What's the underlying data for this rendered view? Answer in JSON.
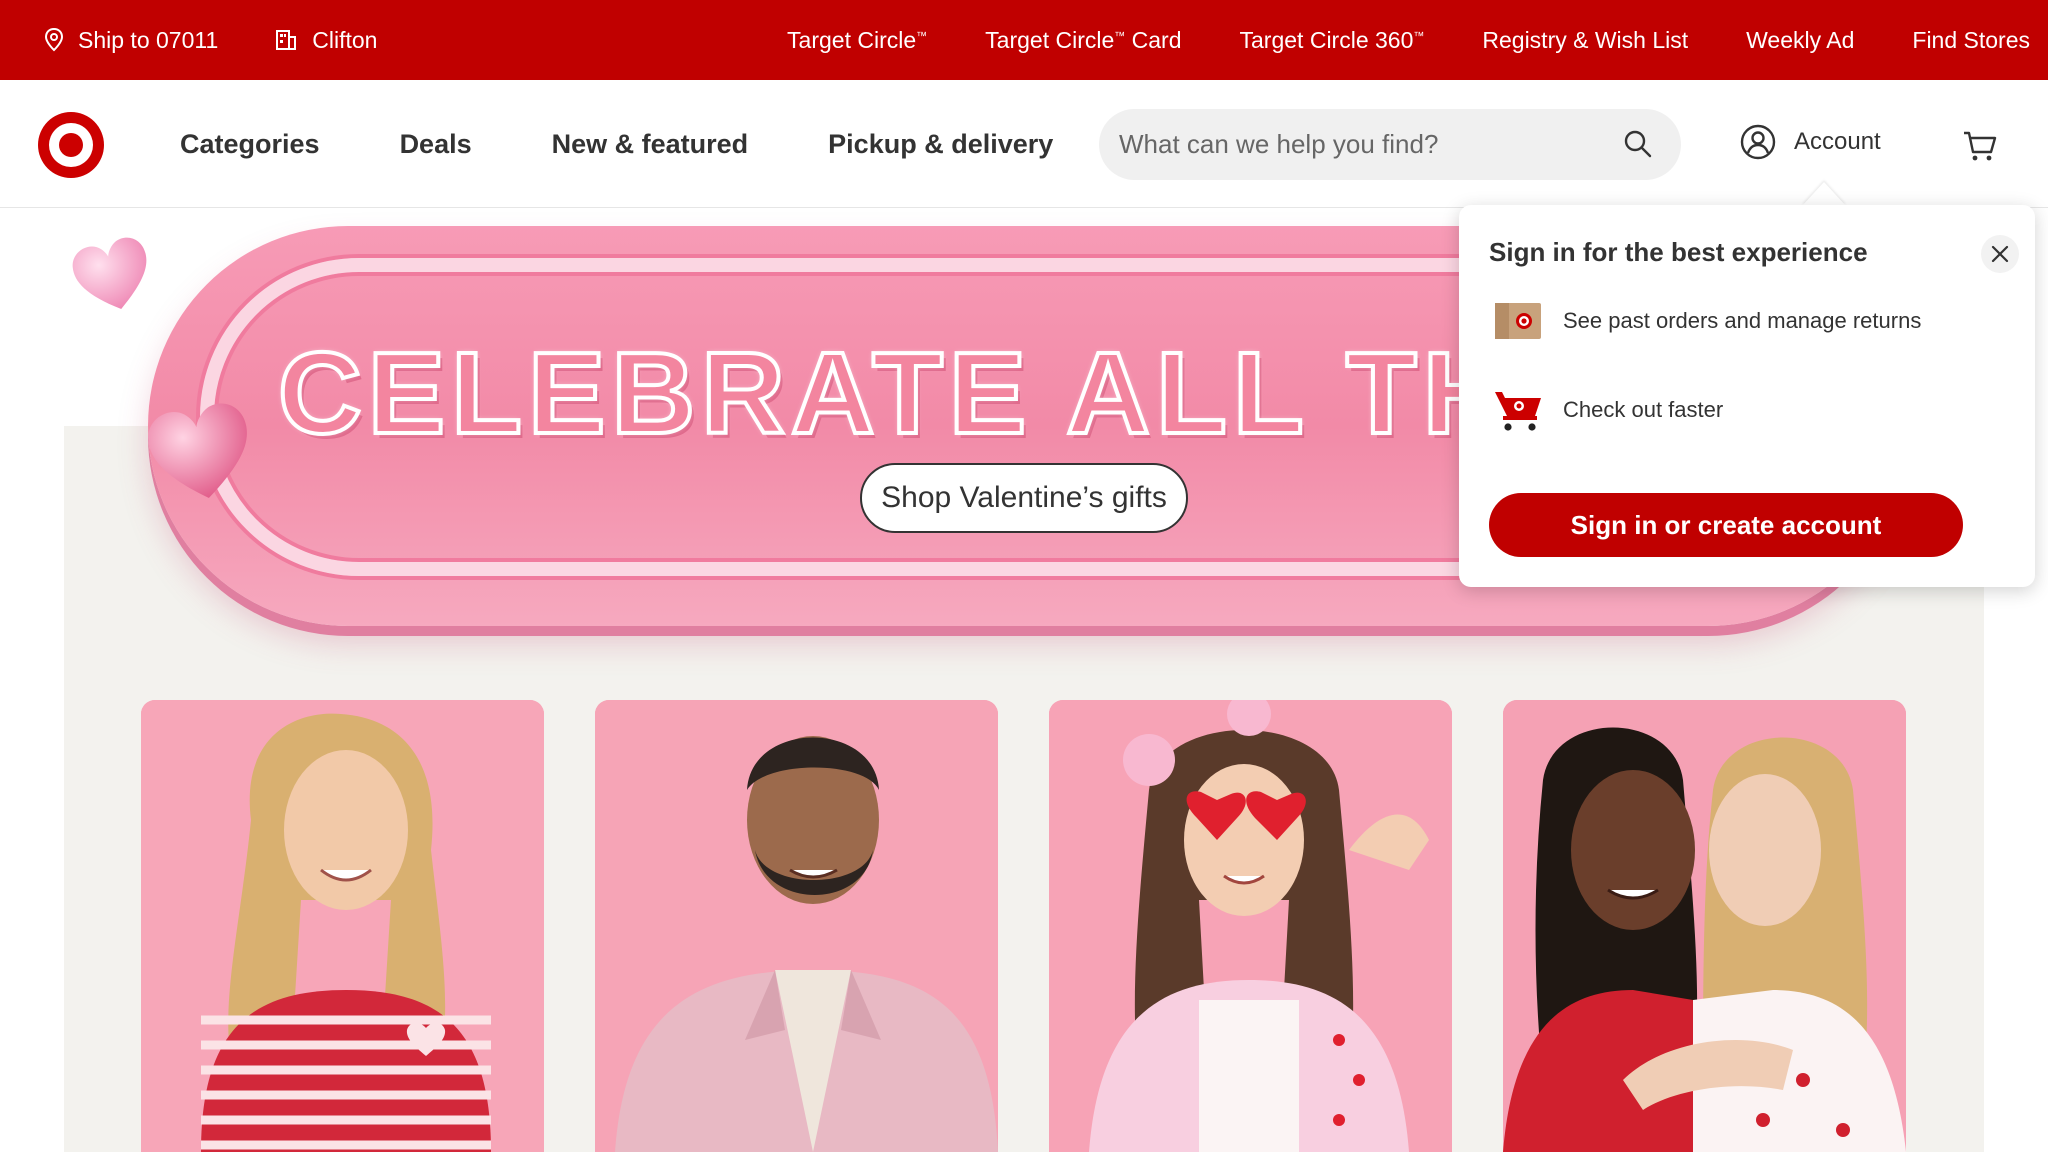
{
  "utility_bar": {
    "ship_to": "Ship to 07011",
    "store": "Clifton",
    "links": [
      {
        "label": "Target Circle",
        "sup": "™"
      },
      {
        "label": "Target Circle",
        "sup": "™",
        "suffix": " Card"
      },
      {
        "label": "Target Circle 360",
        "sup": "™"
      },
      {
        "label": "Registry & Wish List",
        "sup": ""
      },
      {
        "label": "Weekly Ad",
        "sup": ""
      },
      {
        "label": "Find Stores",
        "sup": ""
      }
    ]
  },
  "header": {
    "nav": [
      "Categories",
      "Deals",
      "New & featured",
      "Pickup & delivery"
    ],
    "search_placeholder": "What can we help you find?",
    "account_label": "Account"
  },
  "hero": {
    "headline": "CELEBRATE ALL THE",
    "cta": "Shop Valentine’s gifts"
  },
  "signin_flyout": {
    "title": "Sign in for the best experience",
    "perks": [
      "See past orders and manage returns",
      "Check out faster"
    ],
    "button": "Sign in or create account"
  },
  "colors": {
    "brand_red": "#cc0000",
    "hero_pink": "#f28aa7",
    "tile_pink": "#f7a3b6",
    "page_beige": "#f3f2ee"
  },
  "icons": [
    "location-pin-icon",
    "store-icon",
    "target-logo",
    "search-icon",
    "account-icon",
    "cart-icon",
    "close-icon",
    "package-icon",
    "shopping-cart-icon",
    "heart-decoration"
  ]
}
